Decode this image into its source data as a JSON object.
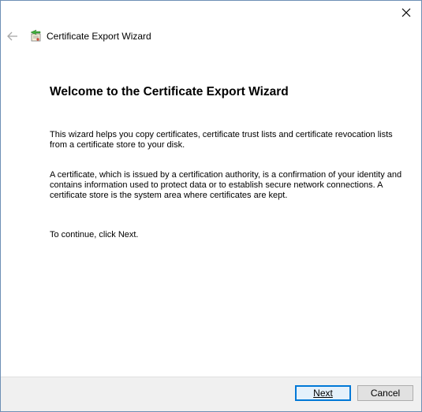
{
  "window": {
    "title": "Certificate Export Wizard"
  },
  "icons": {
    "close": "close-icon",
    "back": "back-arrow-icon",
    "wizard": "certificate-wizard-icon"
  },
  "content": {
    "heading": "Welcome to the Certificate Export Wizard",
    "paragraph1": "This wizard helps you copy certificates, certificate trust lists and certificate revocation lists from a certificate store to your disk.",
    "paragraph2": "A certificate, which is issued by a certification authority, is a confirmation of your identity and contains information used to protect data or to establish secure network connections. A certificate store is the system area where certificates are kept.",
    "paragraph3": "To continue, click Next."
  },
  "buttons": {
    "next_label": "Next",
    "cancel_label": "Cancel"
  },
  "colors": {
    "accent": "#0078d7",
    "footer_bg": "#f0f0f0"
  }
}
